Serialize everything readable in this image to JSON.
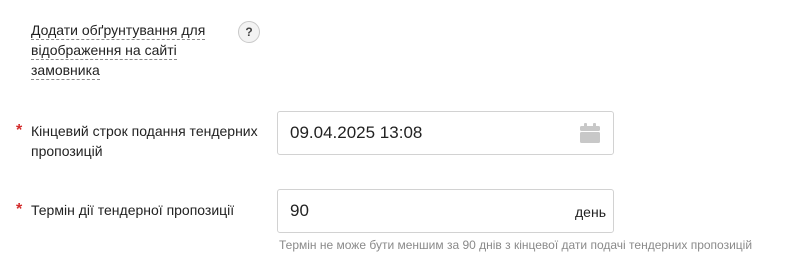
{
  "justification": {
    "link_label": "Додати обґрунтування для відображення на сайті замовника",
    "help_glyph": "?"
  },
  "deadline": {
    "required_mark": "*",
    "label": "Кінцевий строк подання тендерних пропозицій",
    "value": "09.04.2025 13:08",
    "icon": "calendar-icon"
  },
  "validity": {
    "required_mark": "*",
    "label": "Термін дії тендерної пропозиції",
    "value": "90",
    "unit": "день",
    "hint": "Термін не може бути меншим за 90 днів з кінцевої дати подачі тендерних пропозицій"
  },
  "colors": {
    "required": "#d32b2b",
    "border": "#d2d2d2",
    "hint": "#8a8a8a",
    "icon": "#c8c8c8"
  }
}
